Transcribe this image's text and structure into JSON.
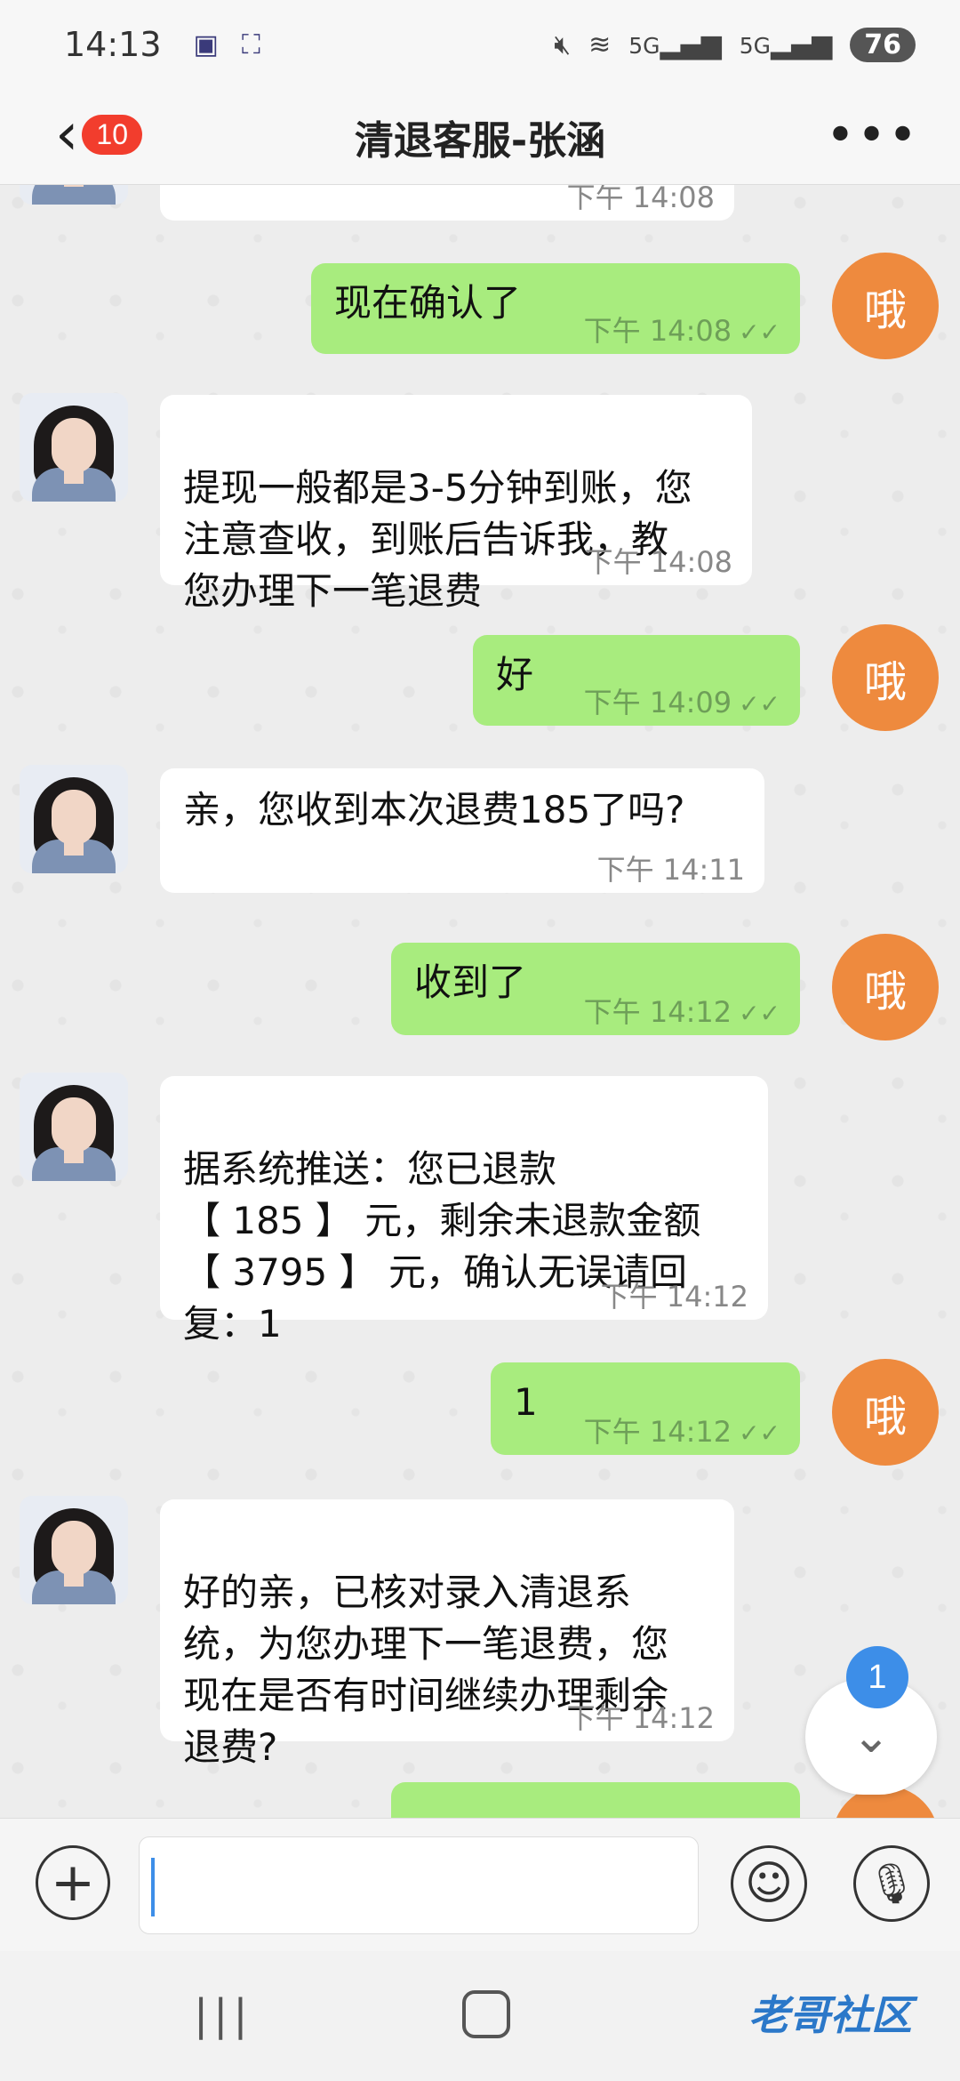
{
  "status_bar": {
    "time": "14:13",
    "battery": "76",
    "signal_1": "5G",
    "signal_2": "5G"
  },
  "header": {
    "title": "清退客服-张涵",
    "unread_count": "10",
    "more": "•••"
  },
  "self_avatar_label": "哦",
  "messages": [
    {
      "side": "in",
      "text": "",
      "time": "下午 14:08"
    },
    {
      "side": "out",
      "text": "现在确认了",
      "time": "下午 14:08"
    },
    {
      "side": "in",
      "text": "提现一般都是3-5分钟到账，您\n注意查收，到账后告诉我，教\n您办理下一笔退费",
      "time": "下午 14:08"
    },
    {
      "side": "out",
      "text": "好",
      "time": "下午 14:09"
    },
    {
      "side": "in",
      "text": "亲，您收到本次退费185了吗?",
      "time": "下午 14:11"
    },
    {
      "side": "out",
      "text": "收到了",
      "time": "下午 14:12"
    },
    {
      "side": "in",
      "text": "据系统推送：您已退款\n【 185 】 元，剩余未退款金额\n【 3795 】 元，确认无误请回\n复：1",
      "time": "下午 14:12"
    },
    {
      "side": "out",
      "text": "1",
      "time": "下午 14:12"
    },
    {
      "side": "in",
      "text": "好的亲，已核对录入清退系\n统，为您办理下一笔退费，您\n现在是否有时间继续办理剩余\n退费?",
      "time": "下午 14:12"
    }
  ],
  "scroll_badge": "1",
  "watermark": "老哥社区"
}
